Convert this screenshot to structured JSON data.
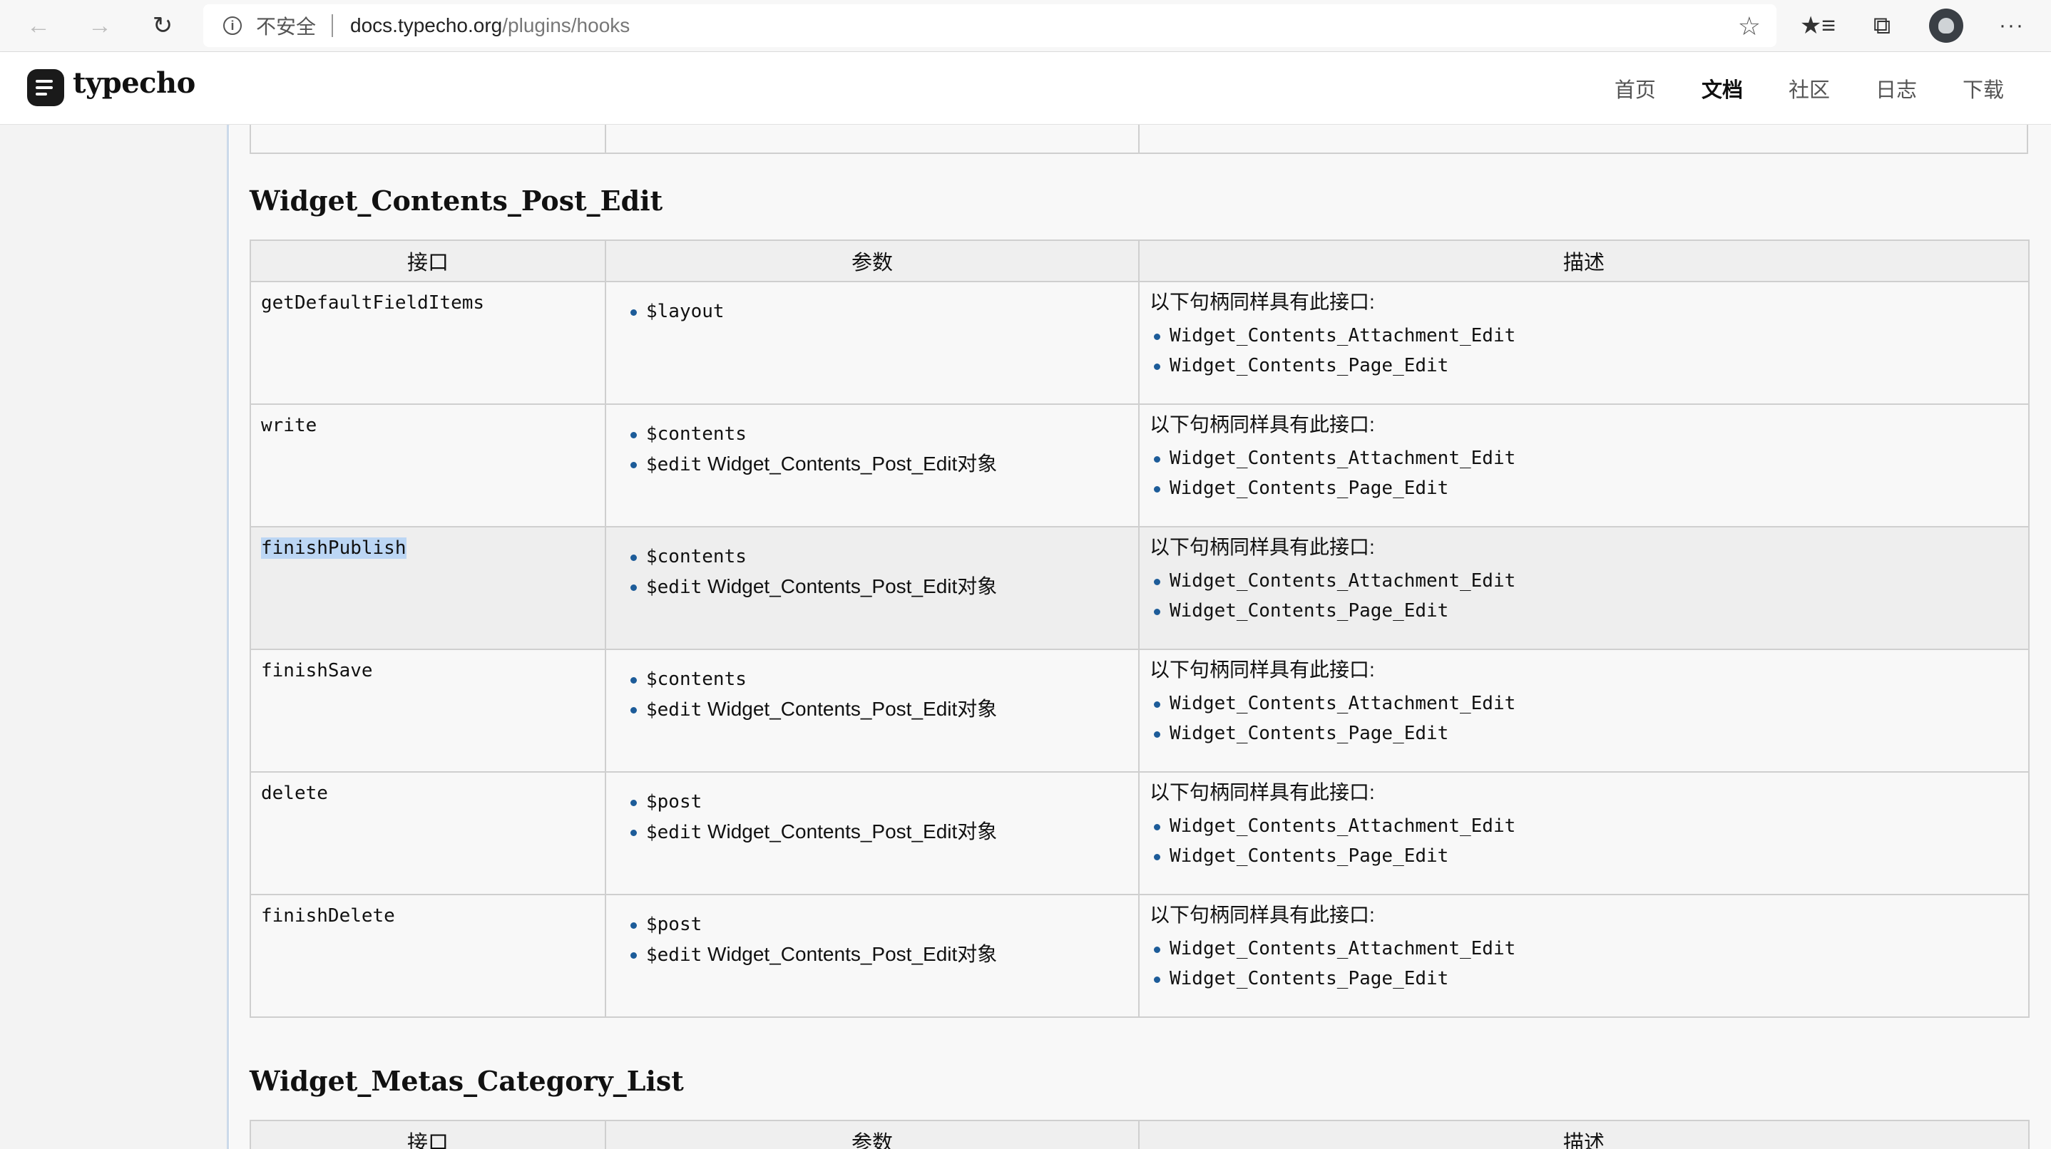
{
  "browser": {
    "address_insecure": "不安全",
    "url_host": "docs.typecho.org",
    "url_path": "/plugins/hooks"
  },
  "site": {
    "logo_text": "typecho",
    "nav": [
      "首页",
      "文档",
      "社区",
      "日志",
      "下载"
    ],
    "nav_current": "文档"
  },
  "section1": {
    "title": "Widget_Contents_Post_Edit",
    "headers": [
      "接口",
      "参数",
      "描述"
    ],
    "desc_intro": "以下句柄同样具有此接口:",
    "rows": [
      {
        "hook": "getDefaultFieldItems",
        "params": [
          {
            "code": "$layout",
            "text": ""
          }
        ],
        "desc_items": [
          "Widget_Contents_Attachment_Edit",
          "Widget_Contents_Page_Edit"
        ]
      },
      {
        "hook": "write",
        "params": [
          {
            "code": "$contents",
            "text": ""
          },
          {
            "code": "$edit",
            "text": " Widget_Contents_Post_Edit对象"
          }
        ],
        "desc_items": [
          "Widget_Contents_Attachment_Edit",
          "Widget_Contents_Page_Edit"
        ]
      },
      {
        "hook": "finishPublish",
        "params": [
          {
            "code": "$contents",
            "text": ""
          },
          {
            "code": "$edit",
            "text": " Widget_Contents_Post_Edit对象"
          }
        ],
        "desc_items": [
          "Widget_Contents_Attachment_Edit",
          "Widget_Contents_Page_Edit"
        ]
      },
      {
        "hook": "finishSave",
        "params": [
          {
            "code": "$contents",
            "text": ""
          },
          {
            "code": "$edit",
            "text": " Widget_Contents_Post_Edit对象"
          }
        ],
        "desc_items": [
          "Widget_Contents_Attachment_Edit",
          "Widget_Contents_Page_Edit"
        ]
      },
      {
        "hook": "delete",
        "params": [
          {
            "code": "$post",
            "text": ""
          },
          {
            "code": "$edit",
            "text": " Widget_Contents_Post_Edit对象"
          }
        ],
        "desc_items": [
          "Widget_Contents_Attachment_Edit",
          "Widget_Contents_Page_Edit"
        ]
      },
      {
        "hook": "finishDelete",
        "params": [
          {
            "code": "$post",
            "text": ""
          },
          {
            "code": "$edit",
            "text": " Widget_Contents_Post_Edit对象"
          }
        ],
        "desc_items": [
          "Widget_Contents_Attachment_Edit",
          "Widget_Contents_Page_Edit"
        ]
      }
    ],
    "selected_hook": "finishPublish"
  },
  "section2": {
    "title": "Widget_Metas_Category_List",
    "headers": [
      "接口",
      "参数",
      "描述"
    ]
  },
  "icons": {
    "back": "back-arrow-icon",
    "forward": "forward-arrow-icon",
    "reload": "reload-icon",
    "info": "info-icon",
    "star": "star-icon",
    "favorites": "favorites-icon",
    "collections": "collections-icon",
    "profile": "avatar",
    "more": "more-icon"
  }
}
